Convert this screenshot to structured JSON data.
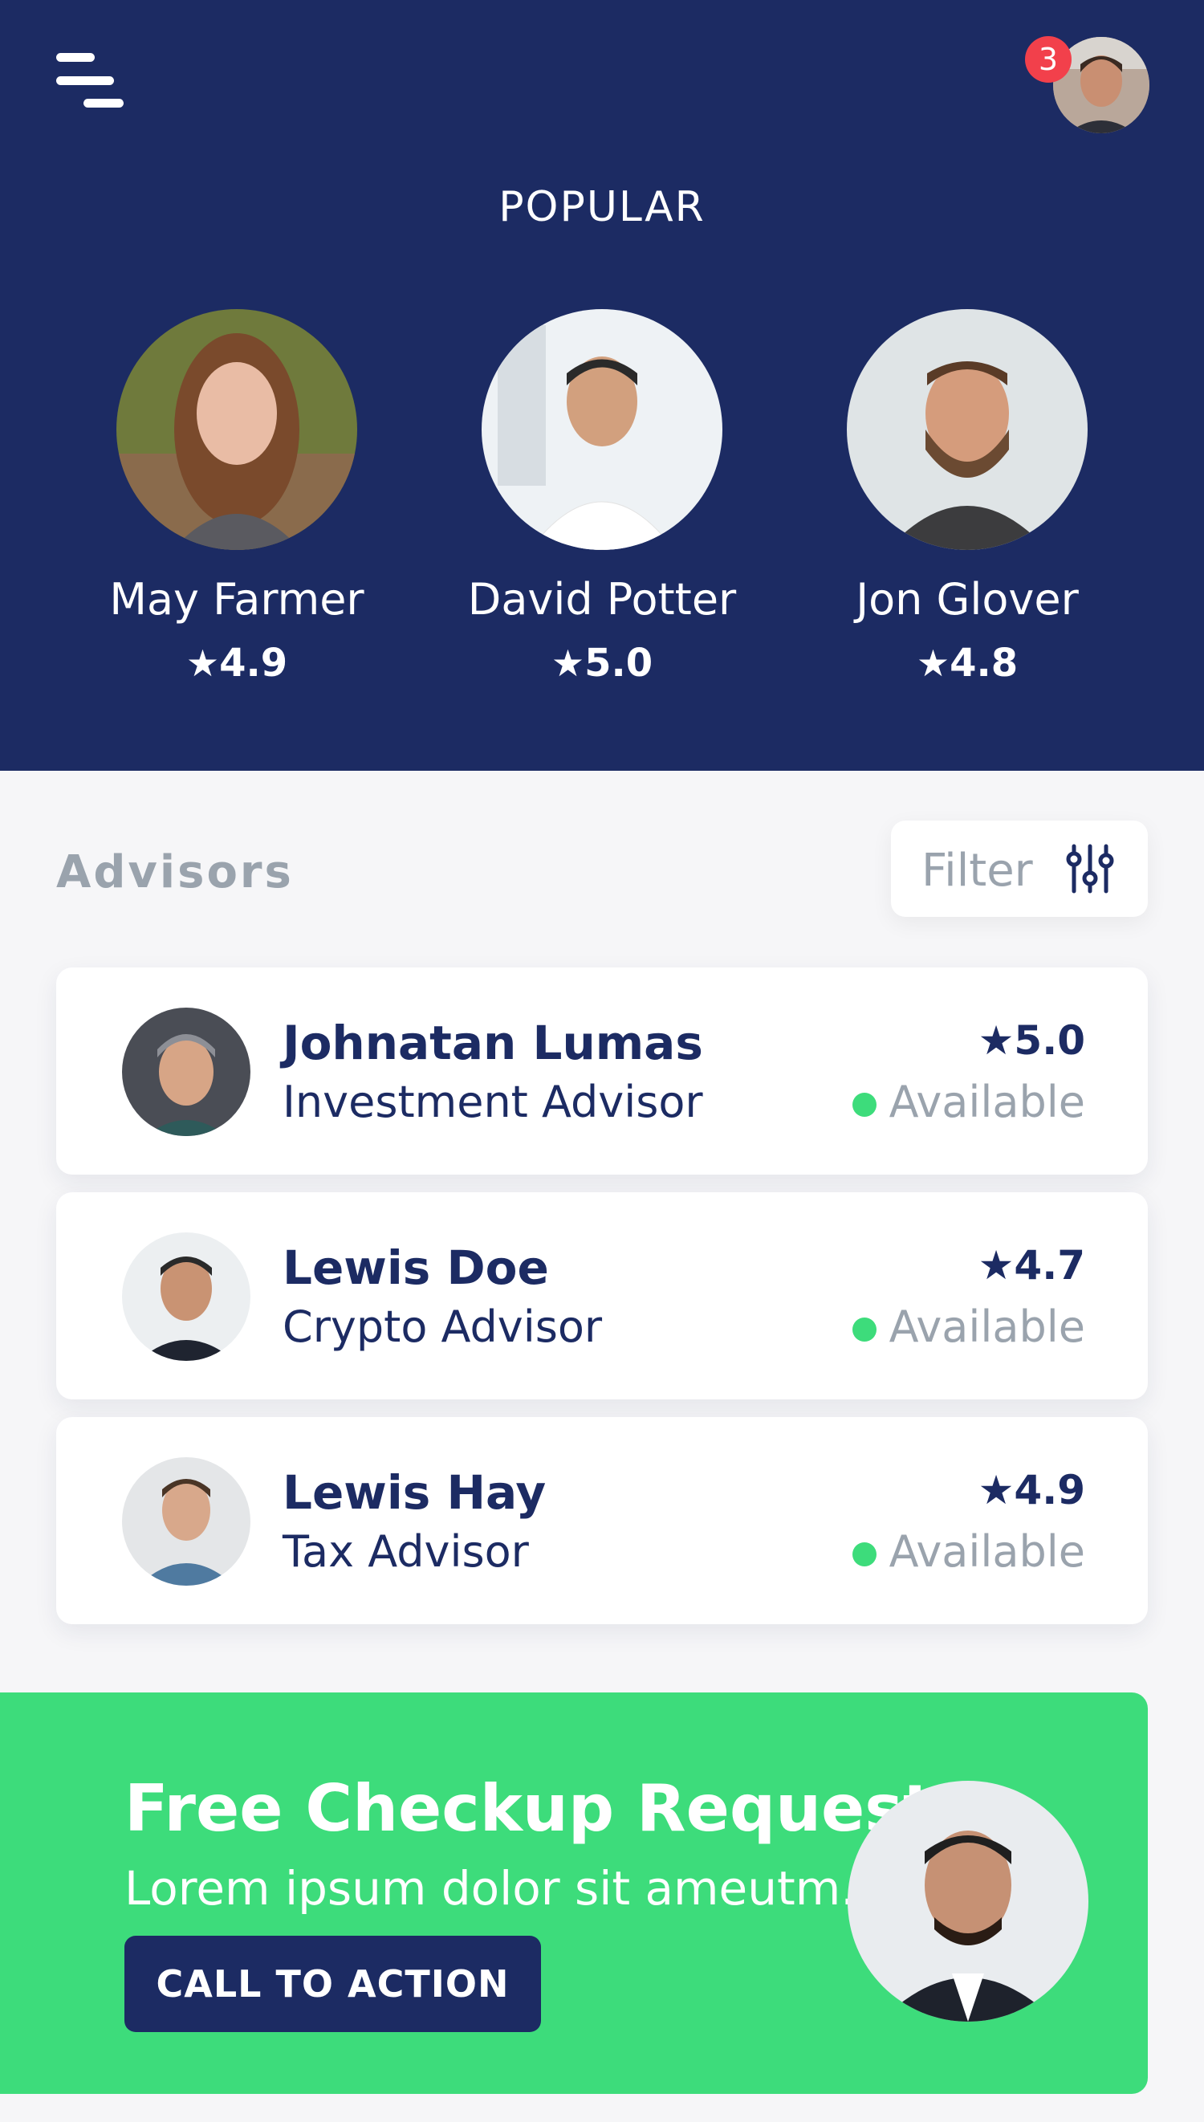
{
  "header": {
    "notification_count": "3",
    "section_title": "POPULAR"
  },
  "popular": [
    {
      "name": "May Farmer",
      "rating": "4.9"
    },
    {
      "name": "David Potter",
      "rating": "5.0"
    },
    {
      "name": "Jon Glover",
      "rating": "4.8"
    }
  ],
  "advisors": {
    "heading": "Advisors",
    "filter_label": "Filter",
    "items": [
      {
        "name": "Johnatan Lumas",
        "role": "Investment Advisor",
        "rating": "5.0",
        "status": "Available"
      },
      {
        "name": "Lewis Doe",
        "role": "Crypto Advisor",
        "rating": "4.7",
        "status": "Available"
      },
      {
        "name": "Lewis Hay",
        "role": "Tax Advisor",
        "rating": "4.9",
        "status": "Available"
      }
    ]
  },
  "cta": {
    "title": "Free Checkup Request",
    "subtitle": "Lorem ipsum dolor sit ameutm.",
    "button_label": "CALL TO ACTION"
  },
  "colors": {
    "navy": "#1c2b63",
    "green": "#3ddc7b",
    "badge_red": "#f2404b",
    "muted_gray": "#9aa3ad"
  },
  "icons": [
    "menu-icon",
    "star-icon",
    "filter-sliders-icon",
    "status-dot-icon"
  ]
}
